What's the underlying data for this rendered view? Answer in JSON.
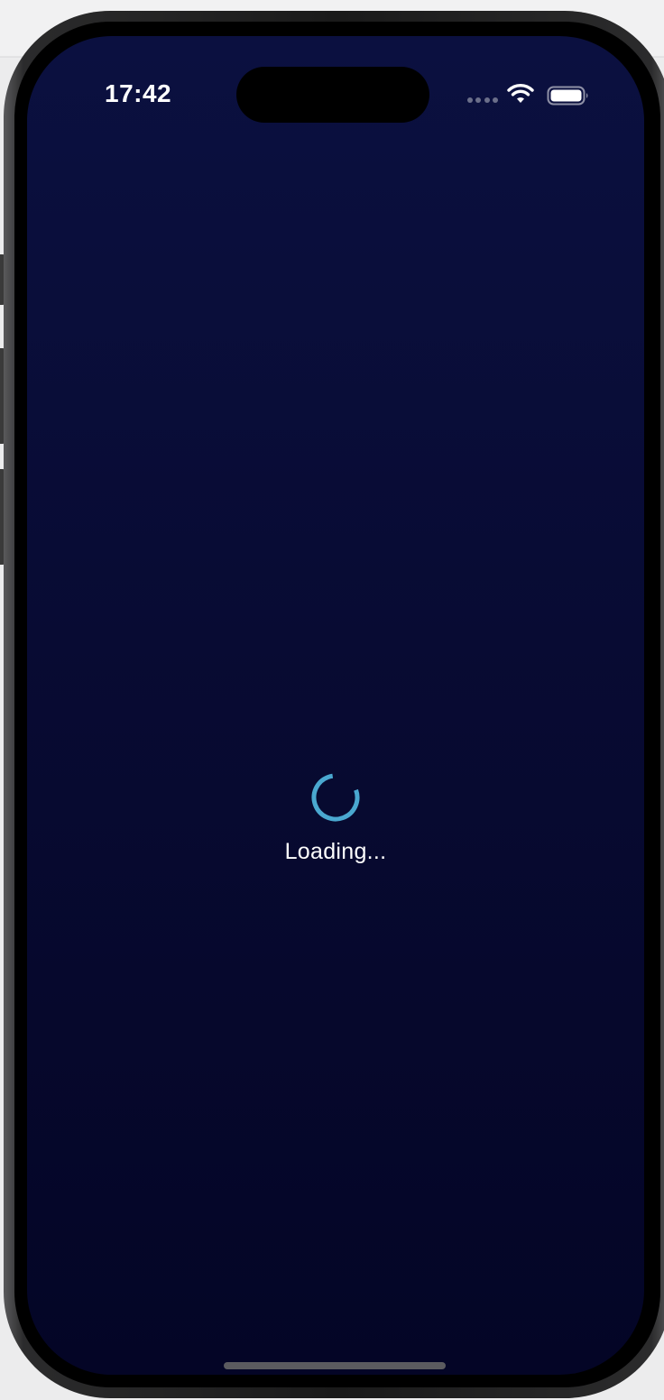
{
  "status_bar": {
    "time": "17:42",
    "icons": [
      "signal-dots-icon",
      "wifi-icon",
      "battery-icon"
    ]
  },
  "main": {
    "loading_text": "Loading..."
  },
  "colors": {
    "background_top": "#0b1040",
    "background_bottom": "#040526",
    "spinner": "#4aa8d0",
    "text": "#ffffff"
  }
}
